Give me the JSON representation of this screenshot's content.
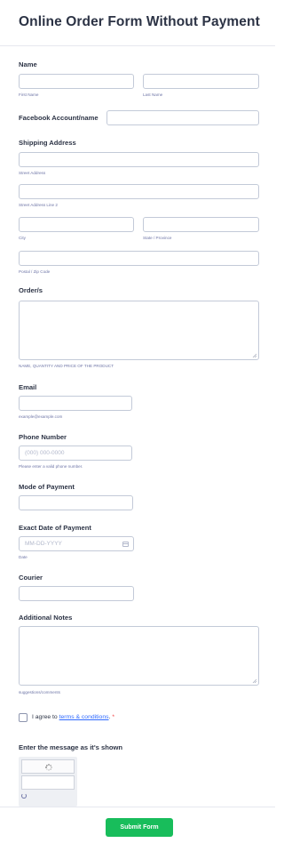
{
  "form": {
    "title": "Online Order Form Without Payment"
  },
  "name": {
    "label": "Name",
    "first_sub": "First Name",
    "last_sub": "Last Name"
  },
  "facebook": {
    "label": "Facebook Account/name"
  },
  "shipping": {
    "label": "Shipping Address",
    "street_sub": "Street Address",
    "street2_sub": "Street Address Line 2",
    "city_sub": "City",
    "state_sub": "State / Province",
    "postal_sub": "Postal / Zip Code"
  },
  "orders": {
    "label": "Order/s",
    "sub": "NAME, QUANTITY AND PRICE OF THE PRODUCT"
  },
  "email": {
    "label": "Email",
    "sub": "example@example.com"
  },
  "phone": {
    "label": "Phone Number",
    "placeholder": "(000) 000-0000",
    "sub": "Please enter a valid phone number."
  },
  "mode_of_payment": {
    "label": "Mode of Payment"
  },
  "payment_date": {
    "label": "Exact Date of Payment",
    "placeholder": "MM-DD-YYYY",
    "sub": "Date"
  },
  "courier": {
    "label": "Courier"
  },
  "notes": {
    "label": "Additional Notes",
    "sub": "suggestions/comments"
  },
  "terms": {
    "prefix": "I agree to ",
    "link": "terms & conditions",
    "suffix": ".",
    "required_mark": "*"
  },
  "captcha": {
    "label": "Enter the message as it's shown"
  },
  "submit": {
    "label": "Submit Form"
  },
  "colors": {
    "submit_bg": "#18bd5b",
    "link": "#2e69ff",
    "required": "#f23a3c",
    "text": "#2c3345"
  },
  "icons": {
    "calendar": "calendar-icon",
    "refresh": "refresh-icon",
    "loading": "loading-spinner-icon"
  }
}
